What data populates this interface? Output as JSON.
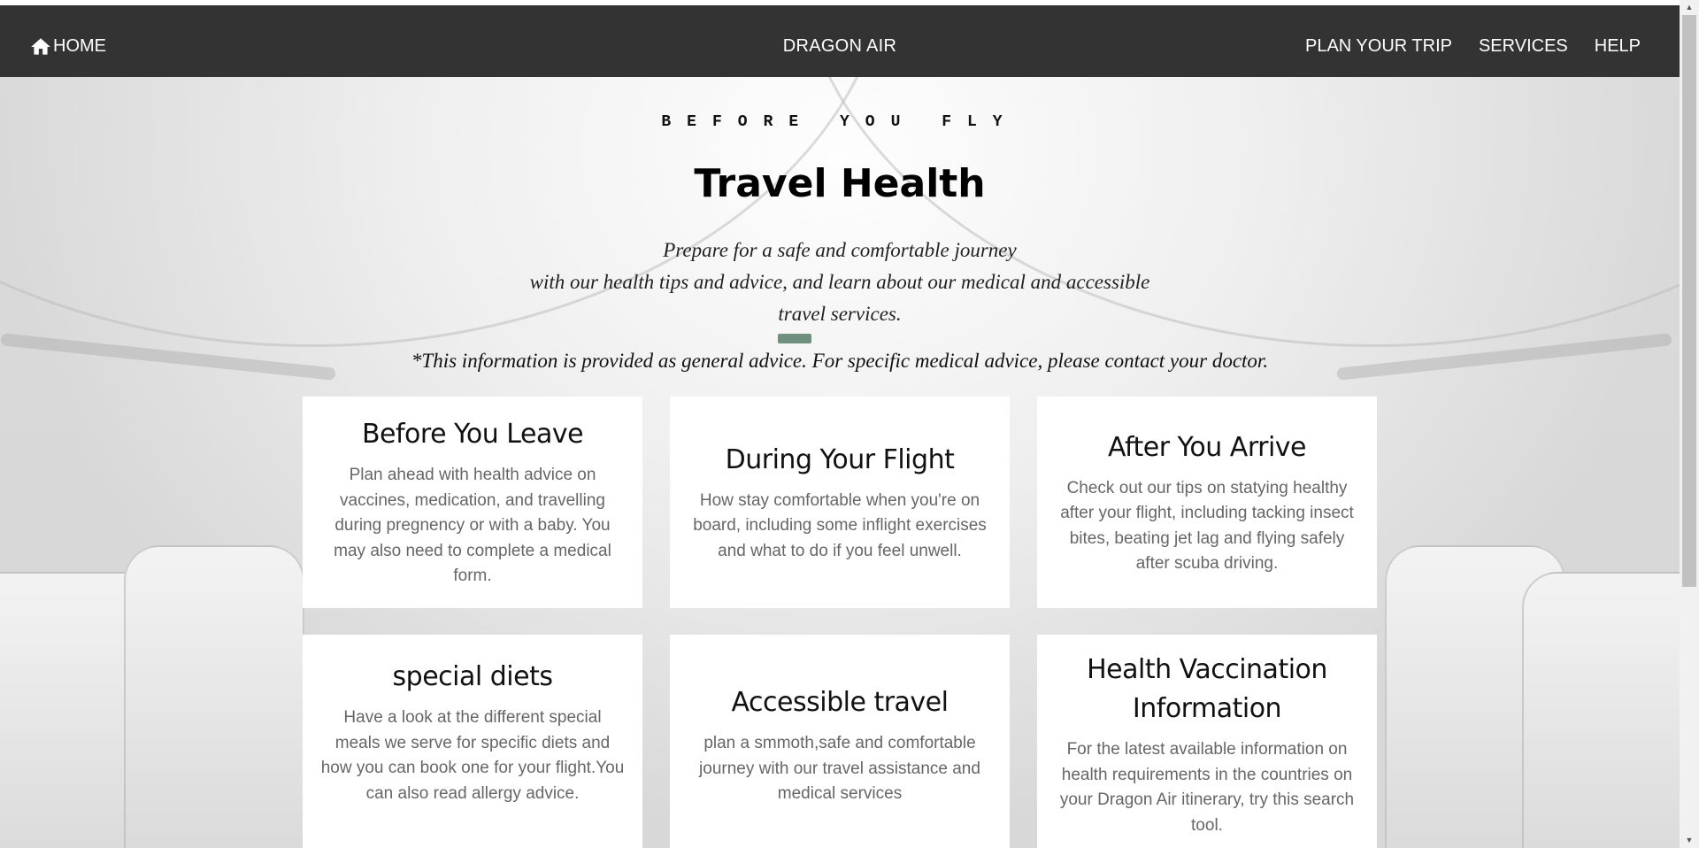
{
  "nav": {
    "home_label": "HOME",
    "brand": "DRAGON AIR",
    "links": [
      "PLAN YOUR TRIP",
      "SERVICES",
      "HELP"
    ]
  },
  "hero": {
    "kicker": "BEFORE YOU FLY",
    "title": "Travel Health",
    "intro_line1": "Prepare for a safe and comfortable journey",
    "intro_line2": "with our health tips and advice, and learn about our medical and accessible",
    "intro_line3": "travel services.",
    "disclaimer": "*This information is provided as general advice. For specific medical advice, please contact your doctor."
  },
  "cards": [
    {
      "title": "Before You Leave",
      "text": "Plan ahead with health advice on vaccines, medication, and travelling during pregnency or with a baby. You may also need to complete a medical form."
    },
    {
      "title": "During Your Flight",
      "text": "How stay comfortable when you're on board, including some inflight exercises and what to do if you feel unwell."
    },
    {
      "title": "After You Arrive",
      "text": "Check out our tips on statying healthy after your flight, including tacking insect bites, beating jet lag and flying safely after scuba driving."
    },
    {
      "title": "special diets",
      "text": "Have a look at the different special meals we serve for specific diets and how you can book one for your flight.You can also read allergy advice."
    },
    {
      "title": "Accessible travel",
      "text": "plan a smmoth,safe and comfortable journey with our travel assistance and medical services"
    },
    {
      "title": "Health Vaccination Information",
      "text": "For the latest available information on health requirements in the countries on your Dragon Air itinerary, try this search tool."
    }
  ]
}
